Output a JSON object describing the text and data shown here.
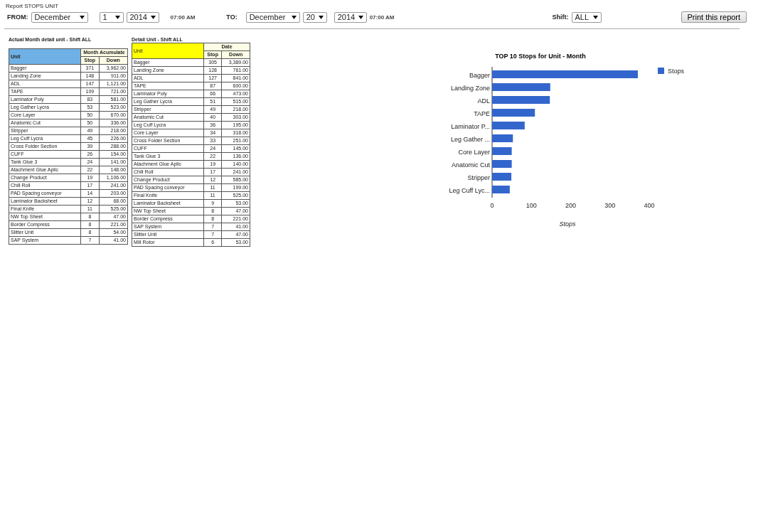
{
  "report_title": "Report STOPS UNIT",
  "filters": {
    "from_label": "FROM:",
    "from_month": "December",
    "from_day": "1",
    "from_year": "2014",
    "from_time": "07:00 AM",
    "to_label": "TO:",
    "to_month": "December",
    "to_day": "20",
    "to_year": "2014",
    "to_time": "07:00 AM",
    "shift_label": "Shift:",
    "shift": "ALL"
  },
  "print_button": "Print this report",
  "month_table": {
    "title": "Actual Month detail unit - Shift ALL",
    "unit_header": "Unit",
    "group_header": "Month Acumulate",
    "stop_header": "Stop",
    "down_header": "Down",
    "rows": [
      [
        "Bagger",
        "371",
        "3,962.00"
      ],
      [
        "Landing Zone",
        "148",
        "911.00"
      ],
      [
        "ADL",
        "147",
        "1,121.00"
      ],
      [
        "TAPE",
        "109",
        "721.00"
      ],
      [
        "Laminator Poly",
        "83",
        "581.00"
      ],
      [
        "Leg Gather Lycra",
        "53",
        "523.00"
      ],
      [
        "Core Layer",
        "50",
        "670.00"
      ],
      [
        "Anatomic Cut",
        "50",
        "336.00"
      ],
      [
        "Stripper",
        "49",
        "218.00"
      ],
      [
        "Leg Cuff Lycra",
        "45",
        "226.00"
      ],
      [
        "Cross Folder Section",
        "39",
        "288.00"
      ],
      [
        "CUFF",
        "26",
        "154.00"
      ],
      [
        "Tank Glue 3",
        "24",
        "141.00"
      ],
      [
        "Atachment Glue Aplic",
        "22",
        "148.00"
      ],
      [
        "Change Product",
        "19",
        "1,106.00"
      ],
      [
        "Chill Roll",
        "17",
        "241.00"
      ],
      [
        "PAD Spacing conveyor",
        "14",
        "203.00"
      ],
      [
        "Laminator Backsheet",
        "12",
        "68.00"
      ],
      [
        "Final Knife",
        "11",
        "525.00"
      ],
      [
        "NW Top Sheet",
        "8",
        "47.00"
      ],
      [
        "Border Compress",
        "8",
        "221.00"
      ],
      [
        "Slitter Unit",
        "8",
        "54.00"
      ],
      [
        "SAP System",
        "7",
        "41.00"
      ]
    ]
  },
  "date_table": {
    "title": "Detail Unit - Shift ALL",
    "unit_header": "Unit",
    "group_header": "Date",
    "stop_header": "Stop",
    "down_header": "Down",
    "rows": [
      [
        "Bagger",
        "305",
        "3,389.00"
      ],
      [
        "Landing Zone",
        "128",
        "761.00"
      ],
      [
        "ADL",
        "127",
        "841.00"
      ],
      [
        "TAPE",
        "87",
        "600.00"
      ],
      [
        "Laminator Poly",
        "66",
        "473.00"
      ],
      [
        "Leg Gather Lycra",
        "51",
        "515.00"
      ],
      [
        "Stripper",
        "49",
        "218.00"
      ],
      [
        "Anatomic Cut",
        "40",
        "303.00"
      ],
      [
        "Leg Cuff Lycra",
        "36",
        "195.00"
      ],
      [
        "Core Layer",
        "34",
        "318.00"
      ],
      [
        "Cross Folder Section",
        "33",
        "251.00"
      ],
      [
        "CUFF",
        "24",
        "145.00"
      ],
      [
        "Tank Glue 3",
        "22",
        "136.00"
      ],
      [
        "Atachment Glue Aplic",
        "19",
        "140.00"
      ],
      [
        "Chill Roll",
        "17",
        "241.00"
      ],
      [
        "Change Product",
        "12",
        "585.00"
      ],
      [
        "PAD Spacing conveyor",
        "11",
        "199.00"
      ],
      [
        "Final Knife",
        "11",
        "525.00"
      ],
      [
        "Laminator Backsheet",
        "9",
        "53.00"
      ],
      [
        "NW Top Sheet",
        "8",
        "47.00"
      ],
      [
        "Border Compress",
        "8",
        "221.00"
      ],
      [
        "SAP System",
        "7",
        "41.00"
      ],
      [
        "Slitter Unit",
        "7",
        "47.00"
      ],
      [
        "Mill Rotor",
        "6",
        "53.00"
      ]
    ]
  },
  "chart_data": {
    "type": "bar",
    "orientation": "horizontal",
    "title": "TOP 10 Stops for Unit - Month",
    "xlabel": "Stops",
    "categories": [
      "Bagger",
      "Landing Zone",
      "ADL",
      "TAPE",
      "Laminator P...",
      "Leg Gather ...",
      "Core Layer",
      "Anatomic Cut",
      "Stripper",
      "Leg Cuff Lyc..."
    ],
    "series": [
      {
        "name": "Stops",
        "color": "#3366cc",
        "values": [
          371,
          148,
          147,
          109,
          83,
          53,
          50,
          50,
          49,
          45
        ]
      }
    ],
    "xlim": [
      0,
      400
    ],
    "xticks": [
      0,
      100,
      200,
      300,
      400
    ]
  }
}
